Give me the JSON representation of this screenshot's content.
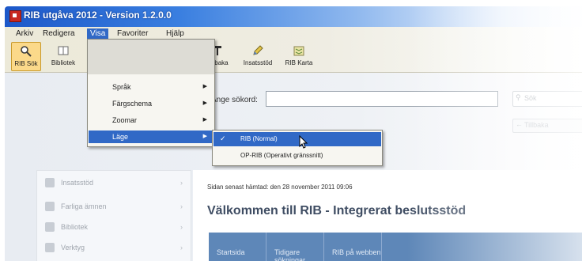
{
  "window": {
    "title": "RIB utgåva 2012 - Version 1.2.0.0"
  },
  "menubar": {
    "items": [
      "Arkiv",
      "Redigera",
      "Visa",
      "Favoriter",
      "Hjälp"
    ],
    "active": "Visa"
  },
  "toolbar": {
    "buttons": [
      {
        "label": "RIB Sök",
        "icon": "search-icon",
        "selected": true
      },
      {
        "label": "Bibliotek",
        "icon": "book-icon"
      },
      {
        "label": "Tillbaka",
        "icon": "tool-icon"
      },
      {
        "label": "Insatsstöd",
        "icon": "pencil-icon"
      },
      {
        "label": "RIB Karta",
        "icon": "map-icon"
      }
    ]
  },
  "view_menu": {
    "items": [
      "Språk",
      "Färgschema",
      "Zoomar",
      "Läge"
    ],
    "active": "Läge"
  },
  "mode_submenu": {
    "items": [
      {
        "label": "RIB (Normal)",
        "checked": true
      },
      {
        "label": "OP-RIB (Operativt gränssnitt)",
        "checked": false
      }
    ]
  },
  "search": {
    "label": "Ange sökord:",
    "button": "Sök"
  },
  "back_button": "Tillbaka",
  "left_nav": {
    "items": [
      "Insatsstöd",
      "Farliga ämnen",
      "Bibliotek",
      "Verktyg"
    ]
  },
  "main": {
    "updated": "Sidan senast hämtad: den 28 november 2011 09:06",
    "welcome": "Välkommen till RIB - Integrerat beslutsstöd",
    "tabs": [
      "Startsida",
      "Tidigare sökningar",
      "RIB på webben"
    ]
  }
}
